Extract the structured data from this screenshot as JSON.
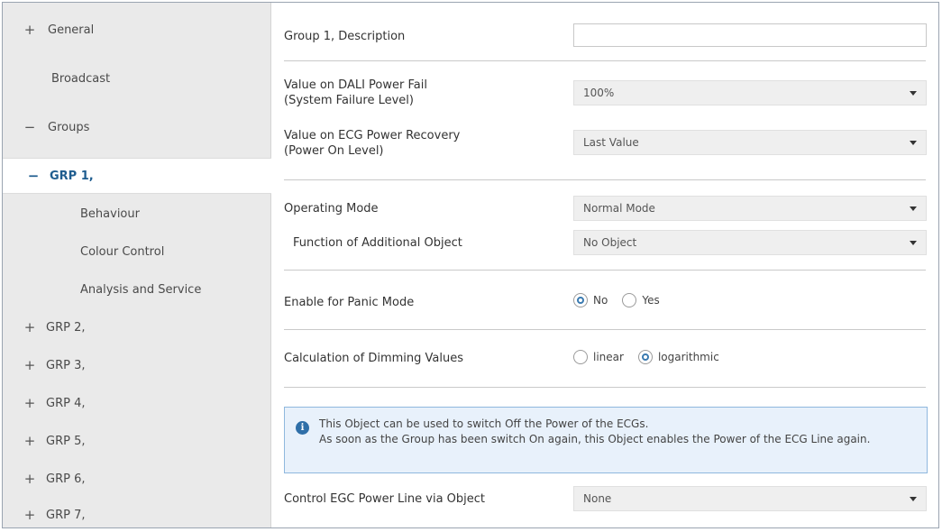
{
  "sidebar": {
    "items": [
      {
        "symbol": "+",
        "label": "General"
      },
      {
        "symbol": "",
        "label": "Broadcast"
      },
      {
        "symbol": "−",
        "label": "Groups"
      },
      {
        "symbol": "−",
        "label": "GRP 1,"
      },
      {
        "symbol": "",
        "label": "Behaviour"
      },
      {
        "symbol": "",
        "label": "Colour Control"
      },
      {
        "symbol": "",
        "label": "Analysis and Service"
      },
      {
        "symbol": "+",
        "label": "GRP 2,"
      },
      {
        "symbol": "+",
        "label": "GRP 3,"
      },
      {
        "symbol": "+",
        "label": "GRP 4,"
      },
      {
        "symbol": "+",
        "label": "GRP 5,"
      },
      {
        "symbol": "+",
        "label": "GRP 6,"
      },
      {
        "symbol": "+",
        "label": "GRP 7,"
      }
    ]
  },
  "main": {
    "description": {
      "label": "Group 1, Description",
      "value": ""
    },
    "power_fail": {
      "label_line1": "Value on DALI Power Fail",
      "label_line2": "(System Failure Level)",
      "value": "100%"
    },
    "power_recovery": {
      "label_line1": "Value on ECG Power Recovery",
      "label_line2": "(Power On Level)",
      "value": "Last Value"
    },
    "operating_mode": {
      "label": "Operating Mode",
      "value": "Normal Mode"
    },
    "additional_object": {
      "label": "Function of Additional Object",
      "value": "No Object"
    },
    "panic_mode": {
      "label": "Enable for Panic Mode",
      "option_no": "No",
      "option_yes": "Yes",
      "selected": "No"
    },
    "dimming": {
      "label": "Calculation of Dimming Values",
      "option_linear": "linear",
      "option_log": "logarithmic",
      "selected": "logarithmic"
    },
    "info": {
      "line1": "This Object can be used to switch Off the Power of the ECGs.",
      "line2": "As soon as the Group has been switch On again, this Object enables the Power of the ECG Line again."
    },
    "power_line": {
      "label": "Control EGC Power Line via Object",
      "value": "None"
    }
  },
  "colors": {
    "accent": "#1f5d8f",
    "info_bg": "#e8f1fb",
    "info_border": "#8fb8de"
  }
}
